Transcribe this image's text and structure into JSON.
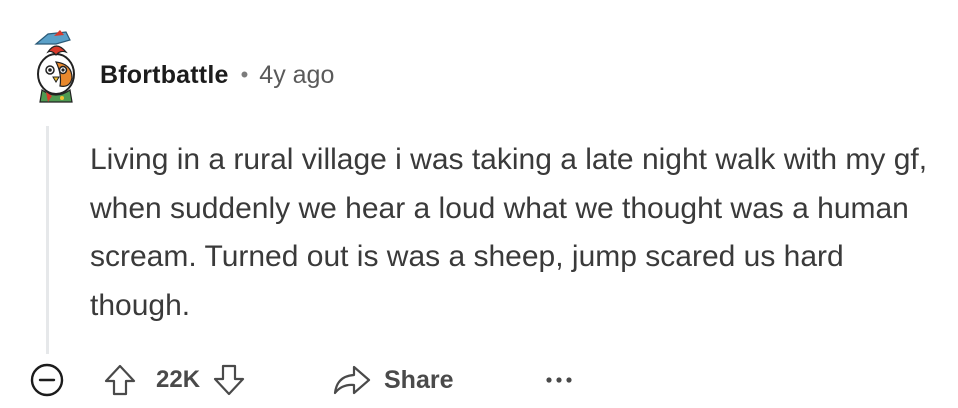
{
  "comment": {
    "author": "Bfortbattle",
    "separator": "•",
    "timestamp": "4y ago",
    "body": "Living in a rural village i was taking a late night walk with my gf, when suddenly we hear a loud what we thought was a human scream. Turned out is was a sheep, jump scared us hard though."
  },
  "actions": {
    "score": "22K",
    "share_label": "Share"
  },
  "icons": {
    "avatar": "cartoon-bird-avatar",
    "collapse": "minus-circle-icon",
    "upvote": "arrow-up-icon",
    "downvote": "arrow-down-icon",
    "share": "share-arrow-icon",
    "more": "more-dots-icon"
  },
  "colors": {
    "text": "#1c1c1c",
    "muted": "#5a5a5a",
    "thread_line": "#e6e8ea"
  }
}
